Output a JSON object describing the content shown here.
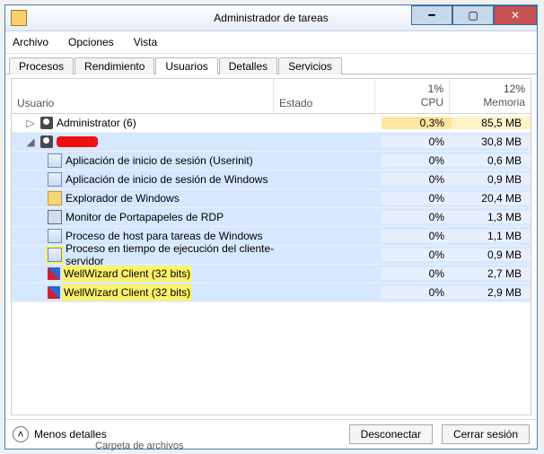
{
  "window": {
    "title": "Administrador de tareas"
  },
  "menu": {
    "archivo": "Archivo",
    "opciones": "Opciones",
    "vista": "Vista"
  },
  "tabs": {
    "procesos": "Procesos",
    "rendimiento": "Rendimiento",
    "usuarios": "Usuarios",
    "detalles": "Detalles",
    "servicios": "Servicios"
  },
  "cols": {
    "usuario": "Usuario",
    "estado": "Estado",
    "cpu_label": "CPU",
    "cpu_pct": "1%",
    "mem_label": "Memoria",
    "mem_pct": "12%"
  },
  "rows": {
    "admin": {
      "name": "Administrator (6)",
      "cpu": "0,3%",
      "mem": "85,5 MB"
    },
    "user2": {
      "name": "",
      "cpu": "0%",
      "mem": "30,8 MB"
    },
    "p0": {
      "name": "Aplicación de inicio de sesión (Userinit)",
      "cpu": "0%",
      "mem": "0,6 MB"
    },
    "p1": {
      "name": "Aplicación de inicio de sesión de Windows",
      "cpu": "0%",
      "mem": "0,9 MB"
    },
    "p2": {
      "name": "Explorador de Windows",
      "cpu": "0%",
      "mem": "20,4 MB"
    },
    "p3": {
      "name": "Monitor de Portapapeles de RDP",
      "cpu": "0%",
      "mem": "1,3 MB"
    },
    "p4": {
      "name": "Proceso de host para tareas de Windows",
      "cpu": "0%",
      "mem": "1,1 MB"
    },
    "p5": {
      "name": "Proceso en tiempo de ejecución del cliente-servidor",
      "cpu": "0%",
      "mem": "0,9 MB"
    },
    "p6": {
      "name": "WellWizard Client (32 bits)",
      "cpu": "0%",
      "mem": "2,7 MB"
    },
    "p7": {
      "name": "WellWizard Client (32 bits)",
      "cpu": "0%",
      "mem": "2,9 MB"
    }
  },
  "footer": {
    "menos": "Menos detalles",
    "desconectar": "Desconectar",
    "cerrar": "Cerrar sesión"
  },
  "remnant": "Carpeta de archivos"
}
